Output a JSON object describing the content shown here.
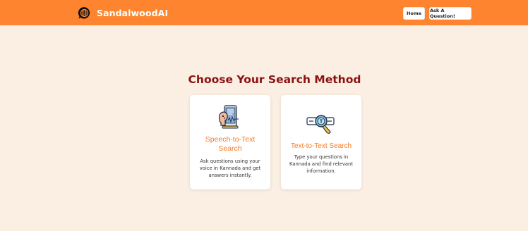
{
  "navbar": {
    "brand": "SandalwoodAI",
    "logo_icon": "globe-chat-icon",
    "home_label": "Home",
    "ask_label": "Ask A Question!",
    "background": "#fe842f"
  },
  "main": {
    "title": "Choose Your Search Method",
    "cards": [
      {
        "icon": "speech-to-text-icon",
        "title_line1": "Speech-to-Text",
        "title_line2": "Search",
        "desc_line1": "Ask questions using your",
        "desc_line2": "voice in Kannada and get",
        "desc_line3": "answers instantly."
      },
      {
        "icon": "text-search-icon",
        "title": "Text-to-Text Search",
        "desc_line1": "Type your questions in",
        "desc_line2": "Kannada and find relevant",
        "desc_line3": "information."
      }
    ]
  },
  "colors": {
    "page_background": "#faefe2",
    "accent": "#f77a27",
    "title": "#8b1212"
  }
}
